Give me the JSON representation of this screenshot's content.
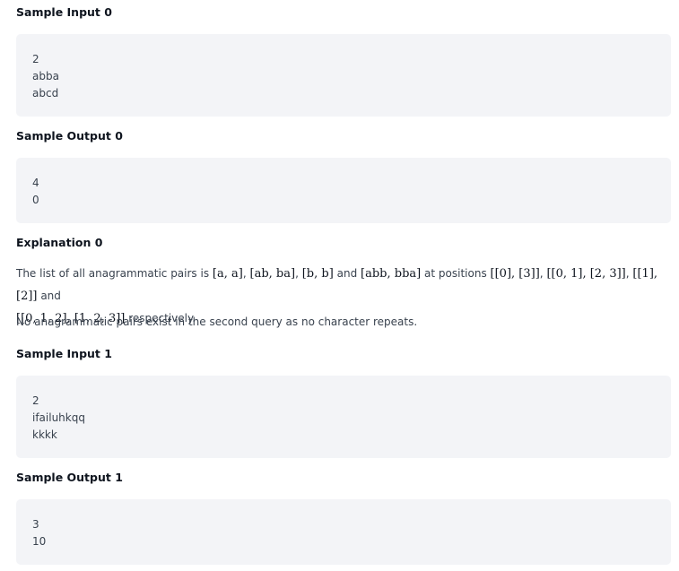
{
  "sample_input_0": {
    "heading": "Sample Input 0",
    "lines": [
      "2",
      "abba",
      "abcd"
    ]
  },
  "sample_output_0": {
    "heading": "Sample Output 0",
    "lines": [
      "4",
      "0"
    ]
  },
  "explanation_0": {
    "heading": "Explanation 0",
    "text_1": "The list of all anagrammatic pairs is",
    "math_pair_1": "[a, a]",
    "sep_1": ",",
    "math_pair_2": "[ab, ba]",
    "sep_2": ",",
    "math_pair_3": "[b, b]",
    "text_and_1": "and",
    "math_pair_4": "[abb, bba]",
    "text_at_positions": "at positions",
    "math_pos_1": "[[0], [3]]",
    "sep_3": ",",
    "math_pos_2": "[[0, 1], [2, 3]]",
    "sep_4": ",",
    "math_pos_3": "[[1], [2]]",
    "text_and_2": "and",
    "math_pos_4": "[[0, 1, 2], [1, 2, 3]]",
    "text_respectively": "respectively.",
    "note": "No anagrammatic pairs exist in the second query as no character repeats."
  },
  "sample_input_1": {
    "heading": "Sample Input 1",
    "lines": [
      "2",
      "ifailuhkqq",
      "kkkk"
    ]
  },
  "sample_output_1": {
    "heading": "Sample Output 1",
    "lines": [
      "3",
      "10"
    ]
  }
}
